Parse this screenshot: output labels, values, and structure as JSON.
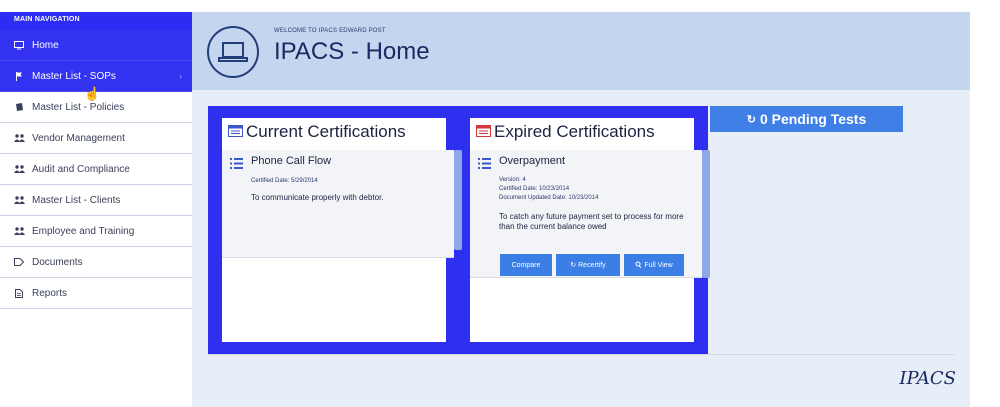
{
  "sidebar": {
    "title": "MAIN NAVIGATION",
    "items": [
      {
        "label": "Home",
        "icon": "monitor-icon"
      },
      {
        "label": "Master List - SOPs",
        "icon": "flag-icon"
      },
      {
        "label": "Master List - Policies",
        "icon": "book-icon"
      },
      {
        "label": "Vendor Management",
        "icon": "users-icon"
      },
      {
        "label": "Audit and Compliance",
        "icon": "users-icon"
      },
      {
        "label": "Master List - Clients",
        "icon": "users-icon"
      },
      {
        "label": "Employee and Training",
        "icon": "users-icon"
      },
      {
        "label": "Documents",
        "icon": "tag-icon"
      },
      {
        "label": "Reports",
        "icon": "file-icon"
      }
    ]
  },
  "header": {
    "welcome": "WELCOME TO IPACS EDWARD POST",
    "title": "IPACS - Home"
  },
  "current": {
    "title": "Current Certifications",
    "entry_title": "Phone Call Flow",
    "certified": "Certified Date: 5/29/2014",
    "description": "To communicate properly with debtor."
  },
  "expired": {
    "title": "Expired Certifications",
    "entry_title": "Overpayment",
    "version": "Version: 4",
    "certified": "Certified Date: 10/23/2014",
    "updated": "Document Updated Date: 10/23/2014",
    "description": "To catch any future payment set to process for more than the current balance owed",
    "buttons": {
      "compare": "Compare",
      "recertify": "Recertify",
      "full_view": "Full View"
    }
  },
  "pending": {
    "label": "0 Pending Tests"
  },
  "footer": {
    "brand": "IPACS"
  },
  "colors": {
    "primary_blue": "#2f2ff0",
    "button_blue": "#3a7ee6",
    "header_bg": "#c3d5ef"
  }
}
